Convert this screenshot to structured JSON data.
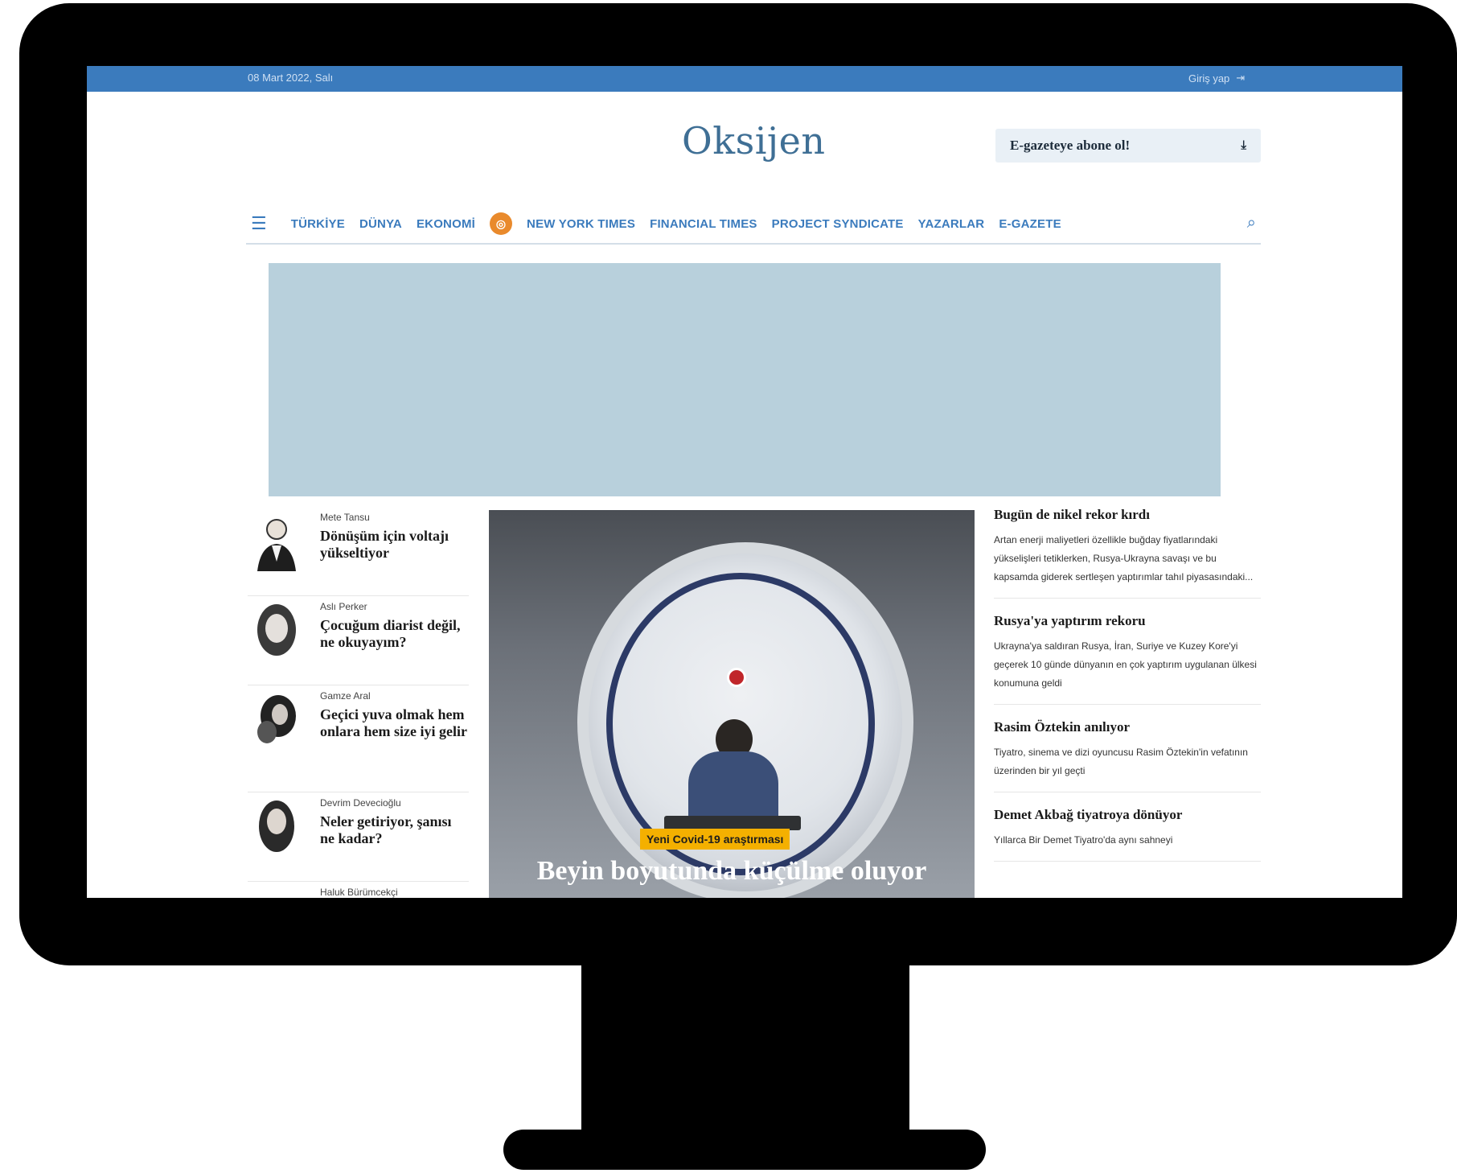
{
  "topbar": {
    "date": "08 Mart 2022, Salı",
    "login_label": "Giriş yap",
    "login_icon": "login-icon"
  },
  "masthead": {
    "logo": "Oksijen",
    "subscribe_label": "E-gazeteye abone ol!",
    "subscribe_icon": "download-icon"
  },
  "nav": {
    "menu_icon": "hamburger-icon",
    "items": [
      "TÜRKİYE",
      "DÜNYA",
      "EKONOMİ",
      "NEW YORK TIMES",
      "FINANCIAL TIMES",
      "PROJECT SYNDICATE",
      "YAZARLAR",
      "E-GAZETE"
    ],
    "search_icon": "search-icon"
  },
  "columnists": [
    {
      "author": "Mete Tansu",
      "title": "Dönüşüm için voltajı yükseltiyor"
    },
    {
      "author": "Aslı Perker",
      "title": "Çocuğum diarist değil, ne okuyayım?"
    },
    {
      "author": "Gamze Aral",
      "title": "Geçici yuva olmak hem onlara hem size iyi gelir"
    },
    {
      "author": "Devrim Devecioğlu",
      "title": "Neler getiriyor, şanısı ne kadar?"
    },
    {
      "author": "Haluk Bürümcekçi",
      "title": ""
    }
  ],
  "hero": {
    "tag": "Yeni Covid-19 araştırması",
    "headline": "Beyin boyutunda küçülme oluyor"
  },
  "news": [
    {
      "title": "Bugün de nikel rekor kırdı",
      "summary": "Artan enerji maliyetleri özellikle buğday fiyatlarındaki yükselişleri tetiklerken, Rusya-Ukrayna savaşı ve bu kapsamda giderek sertleşen yaptırımlar tahıl piyasasındaki..."
    },
    {
      "title": "Rusya'ya yaptırım rekoru",
      "summary": "Ukrayna'ya saldıran Rusya, İran, Suriye ve Kuzey Kore'yi geçerek 10 günde dünyanın en çok yaptırım uygulanan ülkesi konumuna geldi"
    },
    {
      "title": "Rasim Öztekin anılıyor",
      "summary": "Tiyatro, sinema ve dizi oyuncusu Rasim Öztekin'in vefatının üzerinden bir yıl geçti"
    },
    {
      "title": "Demet Akbağ tiyatroya dönüyor",
      "summary": "Yıllarca Bir Demet Tiyatro'da aynı sahneyi"
    }
  ],
  "colors": {
    "topbar": "#3b7bbd",
    "nav_text": "#3b7bbd",
    "ad": "#b8d0dc",
    "tag": "#f4b000"
  }
}
